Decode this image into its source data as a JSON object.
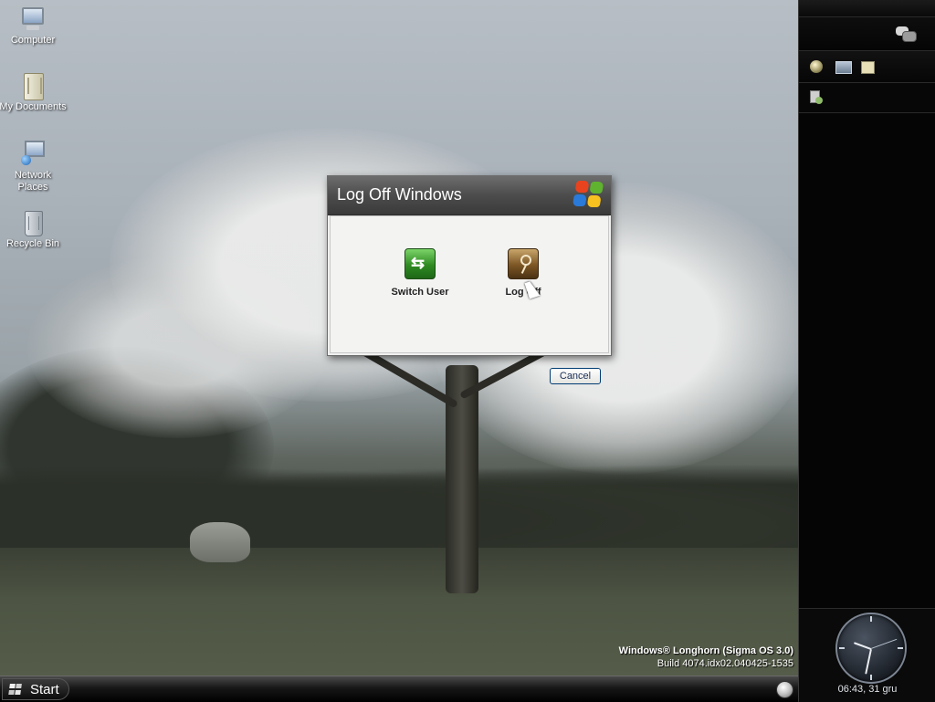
{
  "desktop": {
    "icons": [
      {
        "label": "Computer",
        "icon": "computer-icon"
      },
      {
        "label": "My Documents",
        "icon": "documents-icon"
      },
      {
        "label": "Network Places",
        "icon": "network-places-icon"
      },
      {
        "label": "Recycle Bin",
        "icon": "recycle-bin-icon"
      }
    ],
    "watermark": {
      "line1": "Windows® Longhorn (Sigma OS 3.0)",
      "line2": "Build 4074.idx02.040425-1535"
    }
  },
  "dialog": {
    "title": "Log Off Windows",
    "options": [
      {
        "label": "Switch User",
        "icon": "switch-user-icon",
        "color": "#2e8a21"
      },
      {
        "label": "Log Off",
        "icon": "key-icon",
        "color": "#7b5524"
      }
    ],
    "cancel_label": "Cancel"
  },
  "taskbar": {
    "start_label": "Start"
  },
  "sidebar": {
    "clock_text": "06:43, 31 gru",
    "icons": [
      "messenger-icon",
      "orb-icon",
      "screen-icon",
      "notes-icon",
      "tray-icon"
    ]
  }
}
